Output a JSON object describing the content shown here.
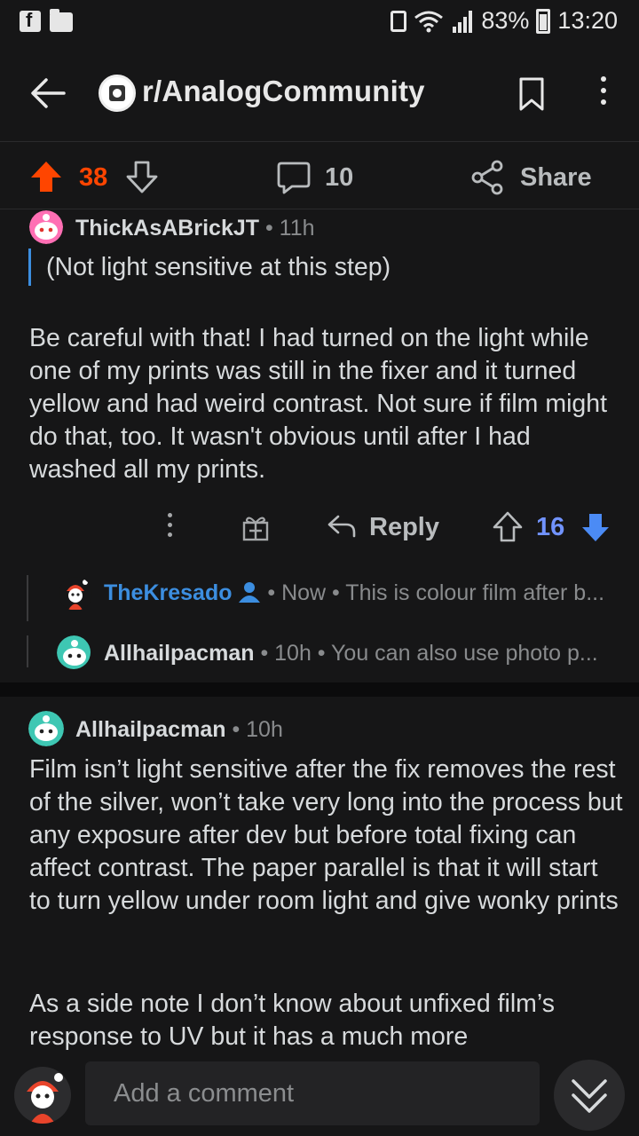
{
  "status_bar": {
    "battery": "83%",
    "time": "13:20"
  },
  "header": {
    "subreddit": "r/AnalogCommunity"
  },
  "post_actions": {
    "score": "38",
    "comments": "10",
    "share": "Share"
  },
  "comment1": {
    "author": "ThickAsABrickJT",
    "meta": " • 11h",
    "quote": "(Not light sensitive at this step)",
    "body": "Be careful with that!  I had turned on the light while one of my prints was still in the fixer and it turned yellow and had weird contrast.  Not sure if film might do that, too.  It wasn't obvious until after I had washed all my prints.",
    "reply_label": "Reply",
    "score": "16"
  },
  "child1": {
    "author": "TheKresado",
    "meta": "• Now • This is colour film after b..."
  },
  "child2": {
    "author": "Allhailpacman",
    "meta": " • 10h • You can also use photo p..."
  },
  "comment2": {
    "author": "Allhailpacman",
    "meta": " • 10h",
    "body1": "Film isn’t light sensitive after the fix removes the rest of the silver, won’t take very long into the process but any exposure after dev but before total fixing can affect contrast. The paper parallel is that it will start to turn yellow under room light and give wonky prints",
    "body2": "As a side note I don’t know about unfixed film’s response to UV but it has a much more"
  },
  "bottom": {
    "placeholder": "Add a comment"
  },
  "colors": {
    "upvote": "#ff4500",
    "downvote": "#7193ff",
    "op_blue": "#3c8ee0",
    "background": "#161617"
  }
}
